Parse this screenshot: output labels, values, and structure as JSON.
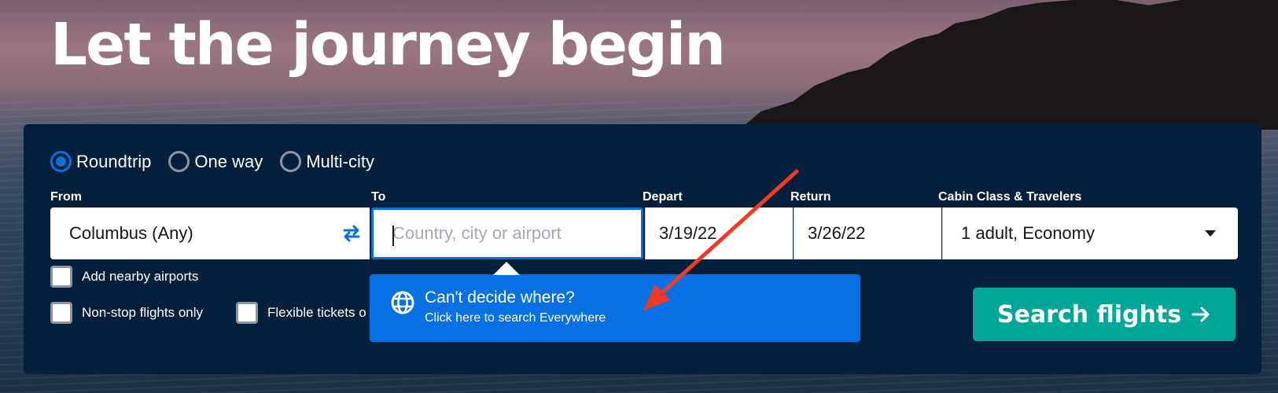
{
  "hero": {
    "title": "Let the journey begin"
  },
  "trip_types": [
    {
      "label": "Roundtrip",
      "selected": true
    },
    {
      "label": "One way",
      "selected": false
    },
    {
      "label": "Multi-city",
      "selected": false
    }
  ],
  "fields": {
    "from_label": "From",
    "from_value": "Columbus (Any)",
    "to_label": "To",
    "to_placeholder": "Country, city or airport",
    "depart_label": "Depart",
    "depart_value": "3/19/22",
    "return_label": "Return",
    "return_value": "3/26/22",
    "cabin_label": "Cabin Class & Travelers",
    "cabin_value": "1 adult, Economy"
  },
  "options": {
    "nearby": "Add nearby airports",
    "nonstop": "Non-stop flights only",
    "flexible": "Flexible tickets o"
  },
  "popover": {
    "title": "Can't decide where?",
    "subtitle": "Click here to search Everywhere"
  },
  "search_button": {
    "label": "Search flights"
  },
  "colors": {
    "panel": "#05203c",
    "accent_blue": "#0770e3",
    "search_green": "#00a698",
    "annotation_red": "#f03a23"
  },
  "icons": {
    "swap": "swap-arrows-icon",
    "dropdown": "chevron-down-icon",
    "globe": "globe-icon",
    "search_arrow": "arrow-right-icon"
  }
}
